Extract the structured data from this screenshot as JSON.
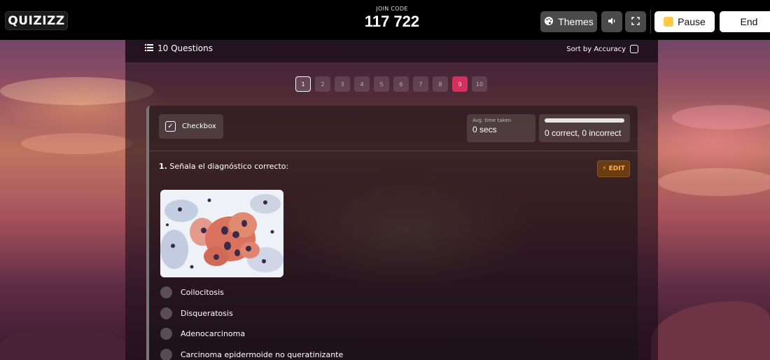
{
  "header": {
    "logo": "QUIZIZZ",
    "join_code_label": "JOIN CODE",
    "join_code": "117 722",
    "themes_label": "Themes",
    "pause_label": "Pause",
    "end_label": "End"
  },
  "toolbar": {
    "question_count": "10 Questions",
    "sort_label": "Sort by Accuracy"
  },
  "pagination": {
    "pages": [
      "1",
      "2",
      "3",
      "4",
      "5",
      "6",
      "7",
      "8",
      "9",
      "10"
    ],
    "active": "1",
    "highlighted": "9",
    "highlight_color": "#d4305d"
  },
  "question": {
    "type_label": "Checkbox",
    "avg_time_label": "Avg. time taken",
    "avg_time_value": "0 secs",
    "accuracy_text": "0 correct, 0 incorrect",
    "number": "1.",
    "text": "Señala el diagnóstico correcto:",
    "edit_label": "EDIT",
    "options": [
      "Coilocitosis",
      "Disqueratosis",
      "Adenocarcinoma",
      "Carcinoma epidermoide no queratinizante"
    ]
  },
  "icons": {
    "themes": "palette-icon",
    "sound": "speaker-icon",
    "fullscreen": "fullscreen-icon",
    "pause": "lightning-icon",
    "list": "list-icon",
    "edit": "lightning-icon"
  },
  "colors": {
    "accent_edit": "#ffb24a",
    "top_bar": "#000000"
  }
}
